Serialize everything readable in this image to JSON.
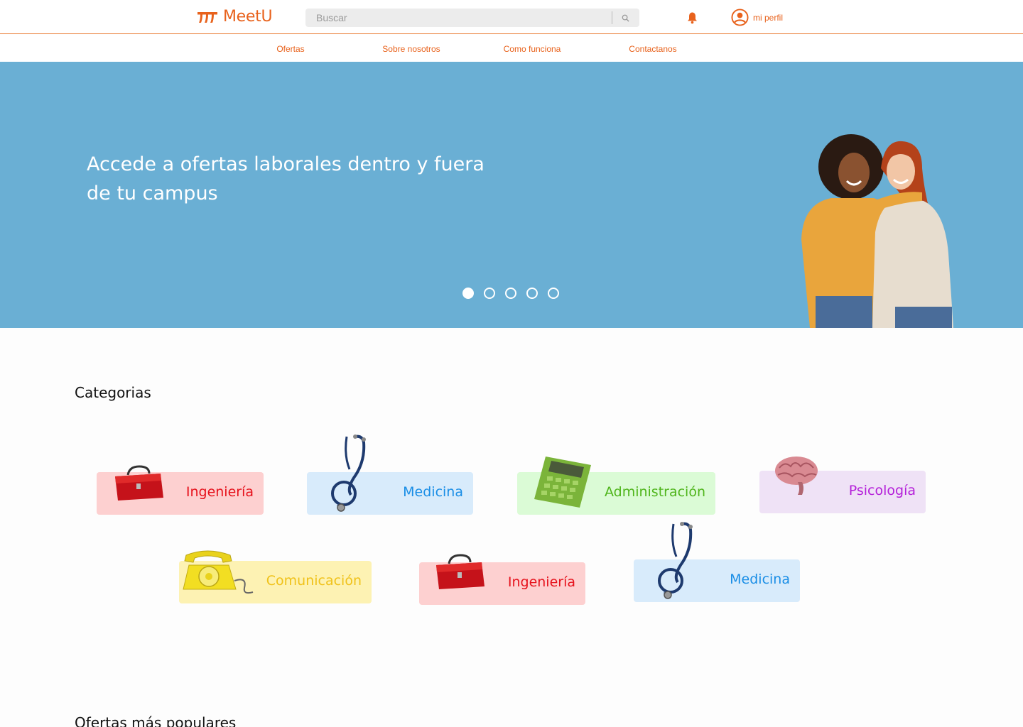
{
  "header": {
    "logo_text": "MeetU",
    "search_placeholder": "Buscar",
    "profile_label": "mi perfil"
  },
  "nav": {
    "items": [
      {
        "label": "Ofertas"
      },
      {
        "label": "Sobre nosotros"
      },
      {
        "label": "Como funciona"
      },
      {
        "label": "Contactanos"
      }
    ]
  },
  "hero": {
    "title": "Accede a ofertas laborales dentro y fuera de tu campus",
    "slides_total": 5,
    "active_slide": 1
  },
  "categories": {
    "title": "Categorias",
    "items": [
      {
        "label": "Ingeniería",
        "icon": "toolbox-icon",
        "bg": "#fdd0d0",
        "color": "#e6121c"
      },
      {
        "label": "Medicina",
        "icon": "stethoscope-icon",
        "bg": "#d8ebfb",
        "color": "#1a8ee6"
      },
      {
        "label": "Administración",
        "icon": "calculator-icon",
        "bg": "#dbfbd6",
        "color": "#4fb51b"
      },
      {
        "label": "Psicología",
        "icon": "brain-icon",
        "bg": "#efe2f6",
        "color": "#b41fd9"
      },
      {
        "label": "Comunicación",
        "icon": "telephone-icon",
        "bg": "#fdf2b3",
        "color": "#f0c21a"
      },
      {
        "label": "Ingeniería",
        "icon": "toolbox-icon",
        "bg": "#fdd0d0",
        "color": "#e6121c"
      },
      {
        "label": "Medicina",
        "icon": "stethoscope-icon",
        "bg": "#d8ebfb",
        "color": "#1a8ee6"
      }
    ]
  },
  "popular": {
    "title": "Ofertas más populares"
  },
  "colors": {
    "brand": "#e8621c",
    "hero_bg": "#6aafd4"
  }
}
